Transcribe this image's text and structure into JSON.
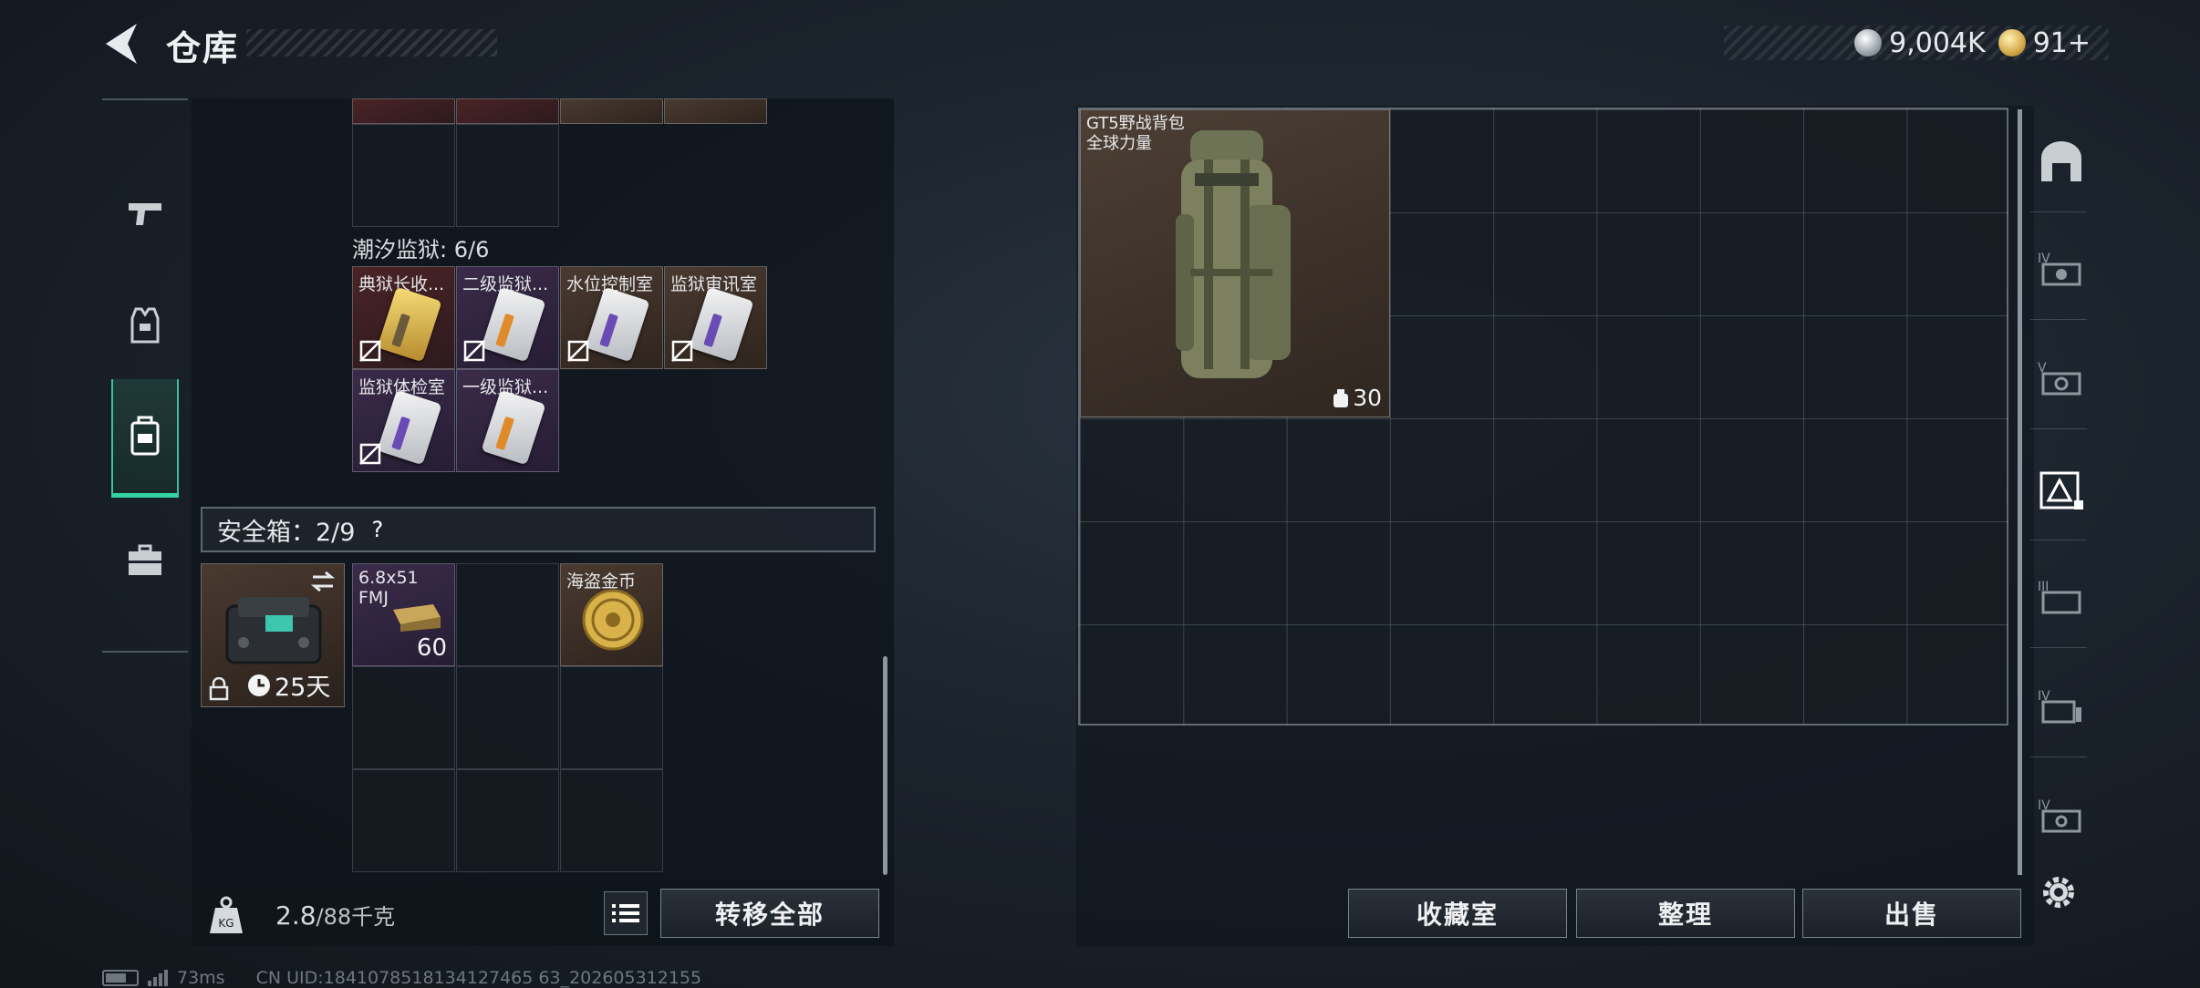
{
  "header": {
    "title": "仓库",
    "currency": [
      {
        "icon": "silver-coin-icon",
        "value": "9,004K"
      },
      {
        "icon": "gold-coin-icon",
        "value": "91+"
      }
    ]
  },
  "left_rail": {
    "items": [
      {
        "icon": "pistol-icon",
        "active": false
      },
      {
        "icon": "armor-vest-icon",
        "active": false
      },
      {
        "icon": "backpack-icon",
        "active": true
      },
      {
        "icon": "toolbox-icon",
        "active": false
      }
    ]
  },
  "inventory": {
    "prison_section_label": "潮汐监狱: 6/6",
    "prison_keys": [
      {
        "name": "典狱长收...",
        "rarity": "red",
        "card": "gold"
      },
      {
        "name": "二级监狱...",
        "rarity": "purple",
        "card": "orange"
      },
      {
        "name": "水位控制室",
        "rarity": "brown",
        "card": "white"
      },
      {
        "name": "监狱审讯室",
        "rarity": "brown",
        "card": "white"
      },
      {
        "name": "监狱体检室",
        "rarity": "purple",
        "card": "white"
      },
      {
        "name": "一级监狱...",
        "rarity": "purple",
        "card": "orange"
      }
    ],
    "safebox_label": "安全箱：2/9",
    "safebox_help": "?",
    "safebox_timer": "25天",
    "safebox_items": [
      {
        "name": "6.8x51 FMJ",
        "count": "60",
        "rarity": "purple"
      },
      {
        "name": "海盗金币",
        "count": "",
        "rarity": "brown"
      }
    ]
  },
  "bottom_bar": {
    "weight_value": "2.8",
    "weight_max": "/88千克",
    "transfer_all": "转移全部"
  },
  "stash": {
    "backpack": {
      "name": "GT5野战背包",
      "brand": "全球力量",
      "capacity": "30"
    },
    "buttons": {
      "collection": "收藏室",
      "sort": "整理",
      "sell": "出售"
    }
  },
  "right_rail": {
    "icons": [
      "base-icon",
      "stash-iv-icon",
      "stash-v-icon",
      "stash-alert-icon",
      "stash-iii-icon",
      "stash-iv-b-icon",
      "stash-iv-c-icon"
    ],
    "settings_icon": "gear-icon"
  },
  "footer": {
    "ping": "73ms",
    "uid": "CN UID:1841078518134127465 63_202605312155"
  }
}
